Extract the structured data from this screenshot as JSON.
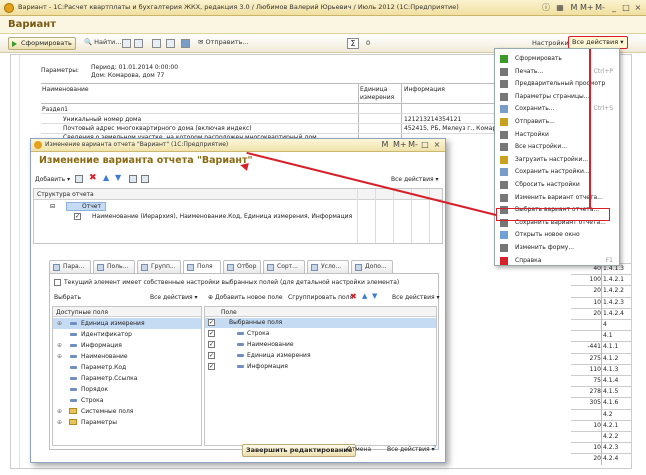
{
  "window": {
    "title": "Вариант - 1С:Расчет квартплаты и бухгалтерия ЖКХ, редакция 3.0 / Любимов Валерий Юрьевич / Июль 2012  (1С:Предприятие)",
    "header": "Вариант"
  },
  "toolbar": {
    "generate": "Сформировать",
    "find": "Найти...",
    "send": "Отправить...",
    "sigma_value": "0",
    "settings": "Настройки",
    "all_actions": "Все действия"
  },
  "report": {
    "params_label": "Параметры:",
    "period": "Период: 01.01.2014 0:00:00",
    "house": "Дом: Комарова, дом 77",
    "col_name": "Наименование",
    "col_unit": "Единица измерения",
    "col_info": "Информация",
    "section": "Раздел1",
    "rows": [
      {
        "name": "Уникальный номер дома",
        "info": "121213214354121"
      },
      {
        "name": "Почтовый адрес многоквартирного дома (включая индекс)",
        "info": "452415, РБ, Мелеуз г., Комар"
      },
      {
        "name": "Сведения о земельном участке, на котором расположен многоквартирный дом",
        "info": ""
      }
    ],
    "right_numbers": [
      {
        "v": "40",
        "c": "1.4.1.3"
      },
      {
        "v": "100",
        "c": "1.4.2.1"
      },
      {
        "v": "20",
        "c": "1.4.2.2"
      },
      {
        "v": "10",
        "c": "1.4.2.3"
      },
      {
        "v": "20",
        "c": "1.4.2.4"
      },
      {
        "v": "",
        "c": "4"
      },
      {
        "v": "",
        "c": "4.1"
      },
      {
        "v": "-441",
        "c": "4.1.1"
      },
      {
        "v": "275",
        "c": "4.1.2"
      },
      {
        "v": "110",
        "c": "4.1.3"
      },
      {
        "v": "75",
        "c": "4.1.4"
      },
      {
        "v": "278",
        "c": "4.1.5"
      },
      {
        "v": "305",
        "c": "4.1.6"
      },
      {
        "v": "",
        "c": "4.2"
      },
      {
        "v": "10",
        "c": "4.2.1"
      },
      {
        "v": "",
        "c": "4.2.2"
      },
      {
        "v": "10",
        "c": "4.2.3"
      },
      {
        "v": "20",
        "c": "4.2.4"
      }
    ]
  },
  "menu": {
    "items": [
      {
        "label": "Сформировать",
        "key": ""
      },
      {
        "label": "Печать...",
        "key": "Ctrl+P"
      },
      {
        "label": "Предварительный просмотр",
        "key": ""
      },
      {
        "label": "Параметры страницы...",
        "key": ""
      },
      {
        "label": "Сохранить...",
        "key": "Ctrl+S"
      },
      {
        "label": "Отправить...",
        "key": ""
      },
      {
        "label": "Настройки",
        "key": ""
      },
      {
        "label": "Все настройки...",
        "key": ""
      },
      {
        "label": "Загрузить настройки...",
        "key": ""
      },
      {
        "label": "Сохранить настройки...",
        "key": ""
      },
      {
        "label": "Сбросить настройки",
        "key": ""
      },
      {
        "label": "Изменить вариант отчета...",
        "key": ""
      },
      {
        "label": "Выбрать вариант отчета...",
        "key": ""
      },
      {
        "label": "Сохранить вариант отчета...",
        "key": ""
      },
      {
        "label": "Открыть новое окно",
        "key": ""
      },
      {
        "label": "Изменить форму...",
        "key": ""
      },
      {
        "label": "Справка",
        "key": "F1"
      }
    ]
  },
  "dialog": {
    "title": "Изменение варианта отчета \"Вариант\"  (1С:Предприятие)",
    "heading": "Изменение варианта отчета \"Вариант\"",
    "add": "Добавить",
    "all_actions": "Все действия",
    "structure_header": "Структура отчета",
    "report_node": "Отчет",
    "grouping": "Наименование (Иерархия), Наименование.Код, Единица измерения, Информация",
    "tabs": [
      "Пара...",
      "Поль...",
      "Групп...",
      "Поля",
      "Отбор",
      "Сорт...",
      "Усло...",
      "Допо..."
    ],
    "own_settings": "Текущий элемент имеет собственные настройки выбранных полей (для детальной настройки элемента)",
    "select": "Выбрать",
    "add_new_field": "Добавить новое поле",
    "group_fields": "Сгруппировать поля",
    "available_header": "Доступные поля",
    "available": [
      "Единица измерения",
      "Идентификатор",
      "Информация",
      "Наименование",
      "Параметр.Код",
      "Параметр.Ссылка",
      "Порядок",
      "Строка",
      "Системные поля",
      "Параметры"
    ],
    "field_header": "Поле",
    "selected_root": "Выбранные поля",
    "selected": [
      "Строка",
      "Наименование",
      "Единица измерения",
      "Информация"
    ],
    "finish": "Завершить редактирование",
    "cancel": "Отмена"
  },
  "colors": {
    "accent": "#d8202a",
    "title": "#7a5a12",
    "selection": "#c5dbf3"
  }
}
